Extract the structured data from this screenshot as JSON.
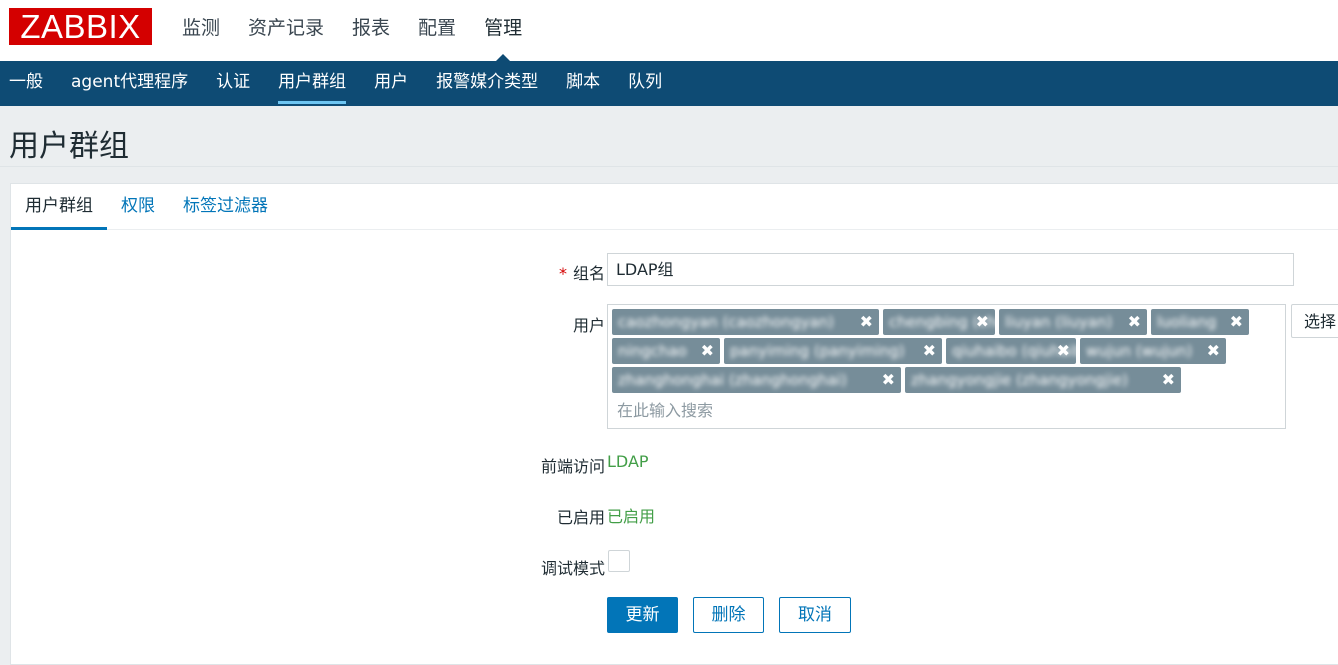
{
  "logo": "ZABBIX",
  "main_menu": [
    "监测",
    "资产记录",
    "报表",
    "配置",
    "管理"
  ],
  "main_menu_active": "管理",
  "sub_menu": [
    "一般",
    "agent代理程序",
    "认证",
    "用户群组",
    "用户",
    "报警媒介类型",
    "脚本",
    "队列"
  ],
  "sub_menu_active": "用户群组",
  "page_title": "用户群组",
  "tabs": [
    "用户群组",
    "权限",
    "标签过滤器"
  ],
  "form": {
    "group_name_label": "组名",
    "required_mark": "*",
    "group_name_value": "LDAP组",
    "users_label": "用户",
    "users": [
      "caozhongyan (caozhongyan)",
      "chengbing (chengbing)",
      "liuyan (liuyan)",
      "luoliang",
      "ningchao",
      "panyiming (panyiming)",
      "qiuhaibo (qiuhaibo)",
      "wujun (wujun)",
      "zhanghonghai (zhanghonghai)",
      "zhangyongjie (zhangyongjie)"
    ],
    "remove_icon": "✖",
    "users_placeholder": "在此输入搜索",
    "select_button": "选择",
    "frontend_access_label": "前端访问",
    "frontend_access_value": "LDAP",
    "enabled_label": "已启用",
    "enabled_value": "已启用",
    "debug_mode_label": "调试模式",
    "debug_mode_checked": false,
    "buttons": {
      "update": "更新",
      "delete": "删除",
      "cancel": "取消"
    }
  },
  "colors": {
    "logo_red": "#d40000",
    "nav_blue": "#0e4b74",
    "link_blue": "#0275b8",
    "chip_gray": "#768d99",
    "green_value": "#429e47"
  }
}
